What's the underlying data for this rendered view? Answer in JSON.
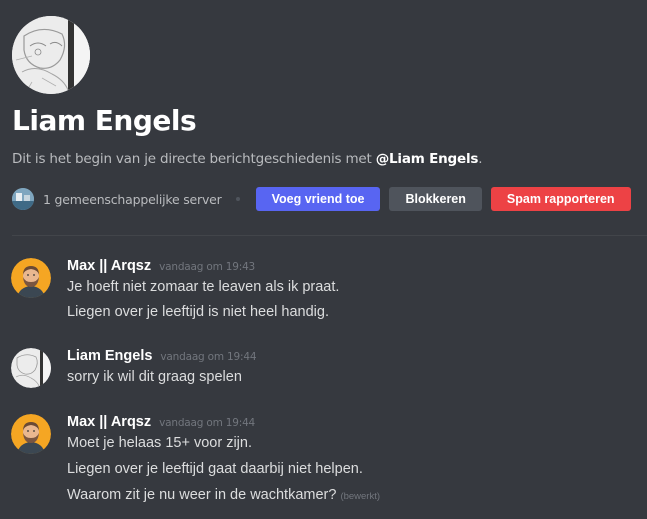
{
  "profile": {
    "name": "Liam Engels",
    "intro_prefix": "Dit is het begin van je directe berichtgeschiedenis met ",
    "intro_mention": "@Liam Engels",
    "intro_suffix": ".",
    "mutual_servers": "1 gemeenschappelijke server"
  },
  "buttons": {
    "add_friend": "Voeg vriend toe",
    "block": "Blokkeren",
    "report_spam": "Spam rapporteren"
  },
  "colors": {
    "background": "#36393f",
    "primary": "#5865f2",
    "secondary": "#4f545c",
    "danger": "#ed4245"
  },
  "messages": [
    {
      "author": "Max || Arqsz",
      "timestamp": "vandaag om 19:43",
      "avatar": "bearded-man-avatar",
      "lines": [
        "Je hoeft niet zomaar te leaven als ik praat.",
        "Liegen over je leeftijd is niet heel handig."
      ]
    },
    {
      "author": "Liam Engels",
      "timestamp": "vandaag om 19:44",
      "avatar": "sketch-avatar",
      "lines": [
        "sorry ik wil dit graag spelen"
      ]
    },
    {
      "author": "Max || Arqsz",
      "timestamp": "vandaag om 19:44",
      "avatar": "bearded-man-avatar",
      "lines": [
        "Moet je helaas 15+ voor zijn.",
        "Liegen over je leeftijd gaat daarbij niet helpen.",
        "Waarom zit je nu weer in de wachtkamer?"
      ],
      "edited_label": "(bewerkt)"
    }
  ]
}
